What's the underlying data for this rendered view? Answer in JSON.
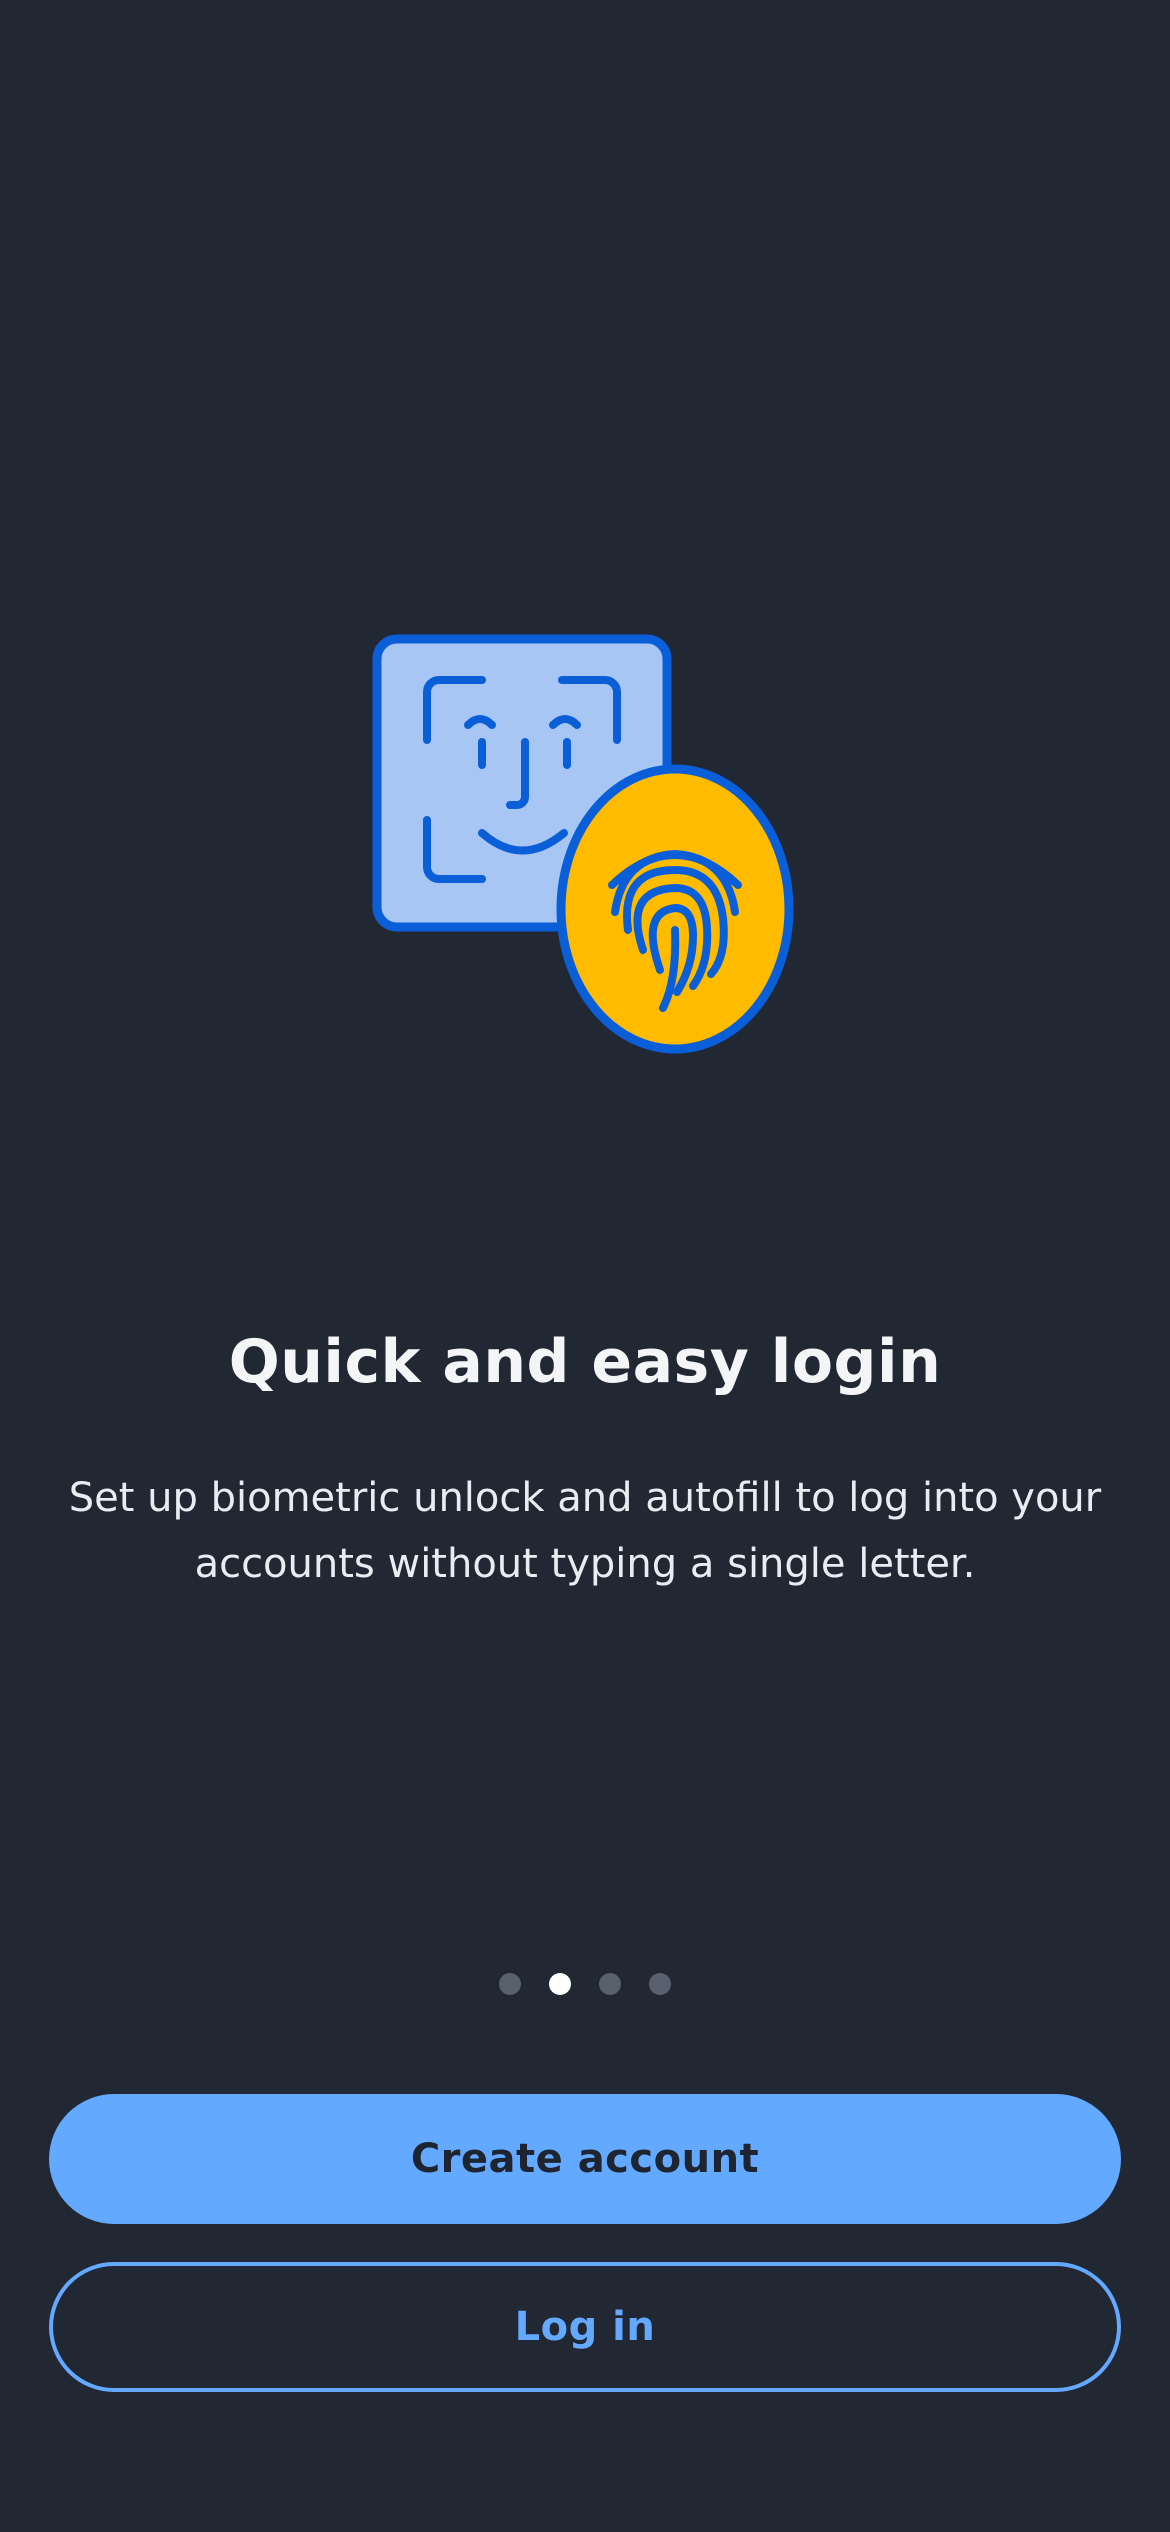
{
  "onboarding": {
    "illustration_icons": [
      "face-id-icon",
      "fingerprint-icon"
    ],
    "title": "Quick and easy login",
    "description": "Set up biometric unlock and autofill to log into your accounts without typing a single letter.",
    "pager": {
      "total": 4,
      "active_index": 1
    }
  },
  "actions": {
    "create_account_label": "Create account",
    "login_label": "Log in"
  },
  "colors": {
    "background": "#212733",
    "accent": "#63a9ff",
    "face_tile": "#a7c6f4",
    "icon_stroke": "#0a5fd8",
    "fingerprint_badge": "#ffbb00"
  }
}
